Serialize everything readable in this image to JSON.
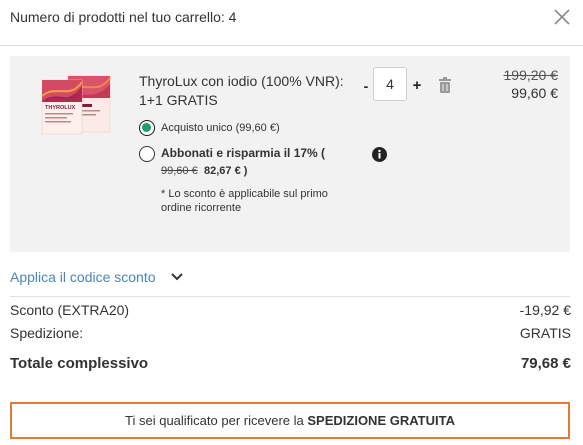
{
  "header": {
    "title": "Numero di prodotti nel tuo carrello: 4"
  },
  "item": {
    "name": "ThyroLux con iodio (100% VNR): 1+1 GRATIS",
    "quantity": "4",
    "old_price": "199,20 €",
    "price": "99,60 €",
    "option_one_time": "Acquisto unico (99,60 €)",
    "option_subscribe": "Abbonati e risparmia il 17% (",
    "subscribe_old_price": "99,60 €",
    "subscribe_new_price": "82,67 € )",
    "subscribe_note": "* Lo sconto è applicabile sul primo ordine ricorrente",
    "image_brand": "THYROLUX"
  },
  "controls": {
    "minus": "-",
    "plus": "+"
  },
  "coupon": {
    "link_label": "Applica il codice sconto"
  },
  "summary": {
    "discount_label": "Sconto (EXTRA20)",
    "discount_value": "-19,92 €",
    "shipping_label": "Spedizione:",
    "shipping_value": "GRATIS",
    "total_label": "Totale complessivo",
    "total_value": "79,68 €"
  },
  "banner": {
    "text_prefix": "Ti sei qualificato per ricevere la",
    "text_bold": "SPEDIZIONE GRATUITA"
  },
  "colors": {
    "accent_green": "#1aa06b",
    "link_blue": "#4a86b5",
    "banner_border": "#e07b39",
    "panel_bg": "#f2f2f2"
  }
}
